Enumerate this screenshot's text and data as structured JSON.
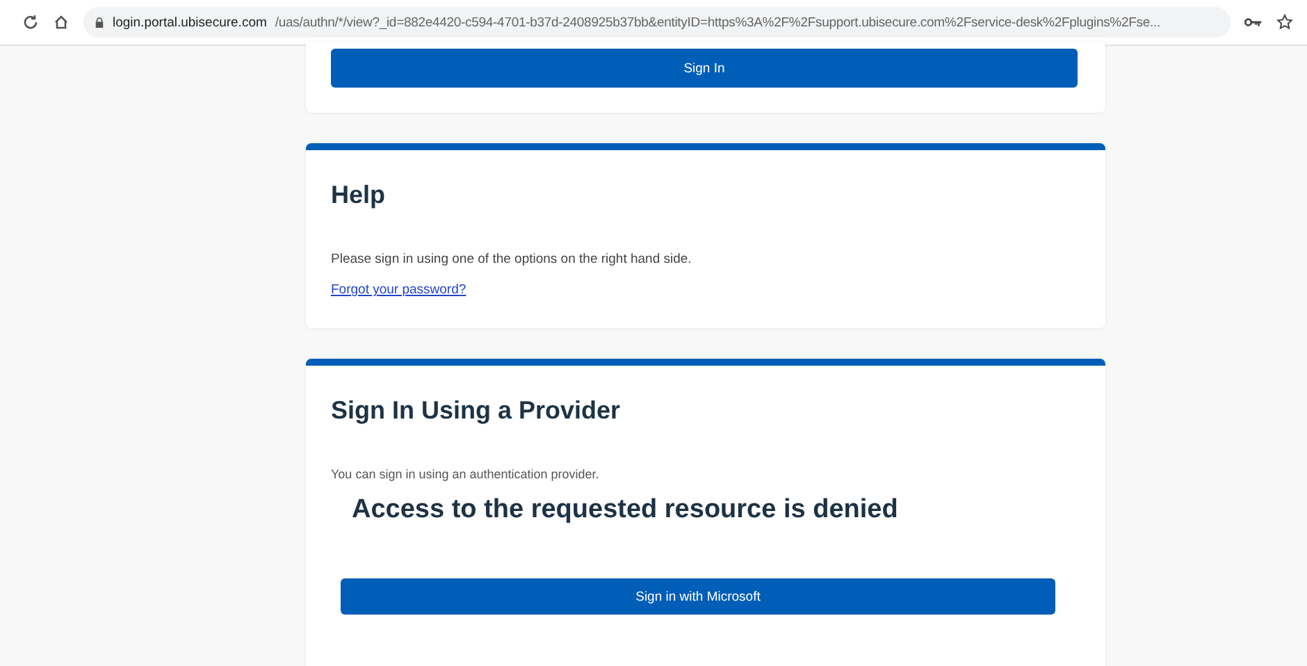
{
  "browser": {
    "url_host": "login.portal.ubisecure.com",
    "url_path": "/uas/authn/*/view?_id=882e4420-c594-4701-b37d-2408925b37bb&entityID=https%3A%2F%2Fsupport.ubisecure.com%2Fservice-desk%2Fplugins%2Fse..."
  },
  "login_card": {
    "button": "Sign In"
  },
  "help_card": {
    "title": "Help",
    "text": "Please sign in using one of the options on the right hand side.",
    "link": "Forgot your password?"
  },
  "provider_card": {
    "title": "Sign In Using a Provider",
    "text": "You can sign in using an authentication provider.",
    "error": "Access to the requested resource is denied",
    "button": "Sign in with Microsoft"
  }
}
